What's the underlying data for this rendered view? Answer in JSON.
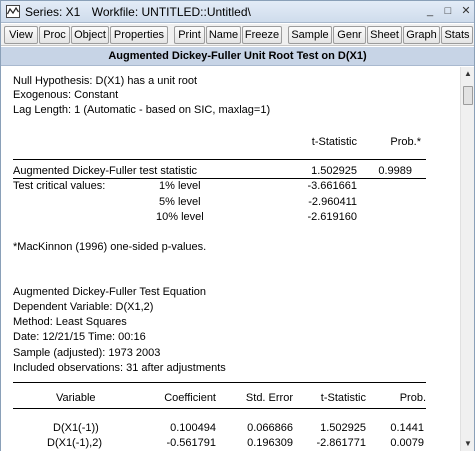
{
  "window": {
    "series_label": "Series: X1",
    "workfile_label": "Workfile: UNTITLED::Untitled\\",
    "controls": {
      "minimize": "_",
      "maximize": "□",
      "close": "✕"
    }
  },
  "toolbar": [
    "View",
    "Proc",
    "Object",
    "Properties",
    "Print",
    "Name",
    "Freeze",
    "Sample",
    "Genr",
    "Sheet",
    "Graph",
    "Stats"
  ],
  "header": "Augmented Dickey-Fuller Unit Root Test on D(X1)",
  "test": {
    "null_hypothesis": "Null Hypothesis: D(X1) has a unit root",
    "exogenous": "Exogenous: Constant",
    "lag_length": "Lag Length: 1 (Automatic - based on SIC, maxlag=1)",
    "col_tstat": "t-Statistic",
    "col_prob": "Prob.*",
    "adf_label": "Augmented Dickey-Fuller test statistic",
    "adf_tstat": "1.502925",
    "adf_prob": "0.9989",
    "critical_label": "Test critical values:",
    "critical": [
      {
        "level": "1% level",
        "value": "-3.661661"
      },
      {
        "level": "5% level",
        "value": "-2.960411"
      },
      {
        "level": "10% level",
        "value": "-2.619160"
      }
    ],
    "footnote": "*MacKinnon (1996) one-sided p-values."
  },
  "equation": {
    "title": "Augmented Dickey-Fuller Test Equation",
    "dependent": "Dependent Variable: D(X1,2)",
    "method": "Method: Least Squares",
    "date": "Date: 12/21/15   Time: 00:16",
    "sample": "Sample (adjusted): 1973 2003",
    "observations": "Included observations: 31 after adjustments",
    "columns": [
      "Variable",
      "Coefficient",
      "Std. Error",
      "t-Statistic",
      "Prob."
    ],
    "rows": [
      {
        "variable": "D(X1(-1))",
        "coefficient": "0.100494",
        "std_error": "0.066866",
        "t_statistic": "1.502925",
        "prob": "0.1441"
      },
      {
        "variable": "D(X1(-1),2)",
        "coefficient": "-0.561791",
        "std_error": "0.196309",
        "t_statistic": "-2.861771",
        "prob": "0.0079"
      }
    ]
  }
}
